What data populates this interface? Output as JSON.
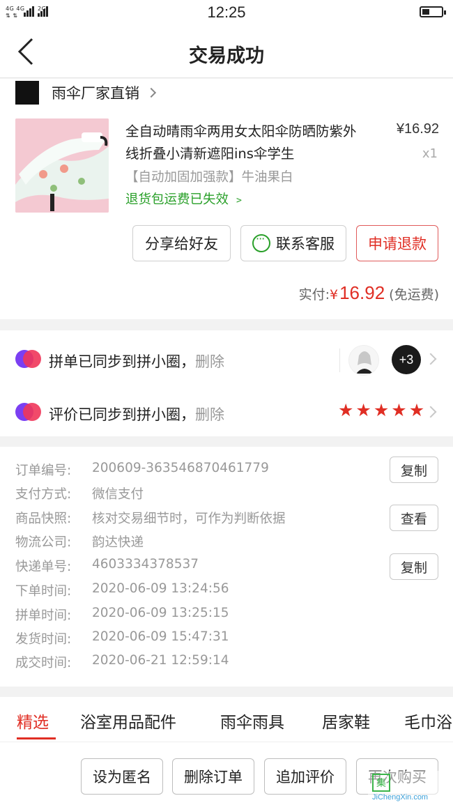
{
  "status_bar": {
    "network": "4G 4G",
    "network2": "2G",
    "time": "12:25"
  },
  "nav": {
    "title": "交易成功"
  },
  "shop": {
    "logo_text": "雨伞厂家直销",
    "name": "雨伞厂家直销"
  },
  "product": {
    "title": "全自动晴雨伞两用女太阳伞防晒防紫外线折叠小清新遮阳ins伞学生",
    "price": "¥16.92",
    "qty": "x1",
    "spec": "【自动加固加强款】牛油果白",
    "return_note": "退货包运费已失效"
  },
  "actions": {
    "share": "分享给好友",
    "contact": "联系客服",
    "refund": "申请退款"
  },
  "payment": {
    "label": "实付:",
    "currency": "¥",
    "amount": "16.92",
    "shipping": "(免运费)"
  },
  "sync": [
    {
      "text": "拼单已同步到拼小圈，",
      "delete": "删除",
      "more_count": "+3"
    },
    {
      "text": "评价已同步到拼小圈，",
      "delete": "删除",
      "rating": 5
    }
  ],
  "order_info": [
    {
      "label": "订单编号:",
      "value": "200609-363546870461779",
      "button": "复制"
    },
    {
      "label": "支付方式:",
      "value": "微信支付"
    },
    {
      "label": "商品快照:",
      "value": "核对交易细节时，可作为判断依据",
      "button": "查看"
    },
    {
      "label": "物流公司:",
      "value": "韵达快递"
    },
    {
      "label": "快递单号:",
      "value": "4603334378537",
      "button": "复制"
    },
    {
      "label": "下单时间:",
      "value": "2020-06-09 13:24:56"
    },
    {
      "label": "拼单时间:",
      "value": "2020-06-09 13:25:15"
    },
    {
      "label": "发货时间:",
      "value": "2020-06-09 15:47:31"
    },
    {
      "label": "成交时间:",
      "value": "2020-06-21 12:59:14"
    }
  ],
  "tabs": [
    "精选",
    "浴室用品配件",
    "雨伞雨具",
    "居家鞋",
    "毛巾浴"
  ],
  "bottom_actions": [
    "设为匿名",
    "删除订单",
    "追加评价",
    "再次购买"
  ],
  "colors": {
    "accent": "#e02e24",
    "green": "#2aa02a"
  },
  "watermark": "JiChengXin.com"
}
